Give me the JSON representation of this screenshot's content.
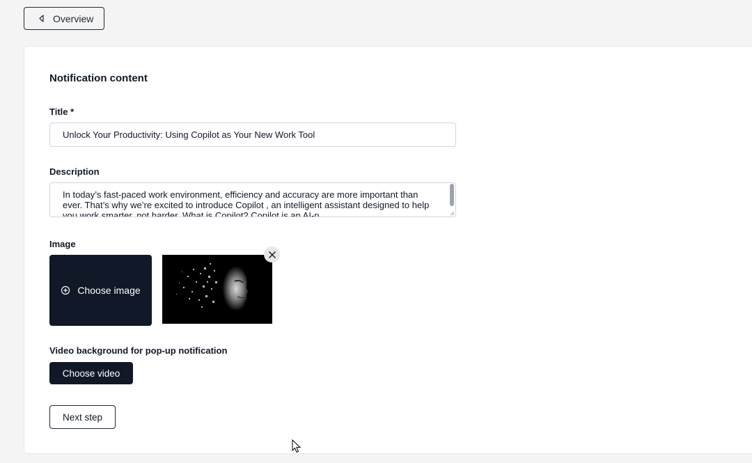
{
  "nav": {
    "back_label": "Overview"
  },
  "form": {
    "section_title": "Notification content",
    "title_label": "Title *",
    "title_value": "Unlock Your Productivity: Using Copilot as Your New Work Tool",
    "description_label": "Description",
    "description_value": "In today’s fast-paced work environment, efficiency and accuracy are more important than ever. That’s why we’re excited to introduce Copilot , an intelligent assistant designed to help you work smarter, not harder. What is Copilot? Copilot is an AI-p",
    "image_label": "Image",
    "choose_image_label": "Choose image",
    "video_label": "Video background for pop-up notification",
    "choose_video_label": "Choose video",
    "next_label": "Next step"
  },
  "colors": {
    "primary_dark": "#111827",
    "page_background": "#f4f4f4",
    "card_background": "#ffffff"
  },
  "icons": {
    "back": "chevron-left-icon",
    "add": "plus-circle-icon",
    "remove": "close-icon",
    "cursor": "mouse-pointer-icon"
  }
}
